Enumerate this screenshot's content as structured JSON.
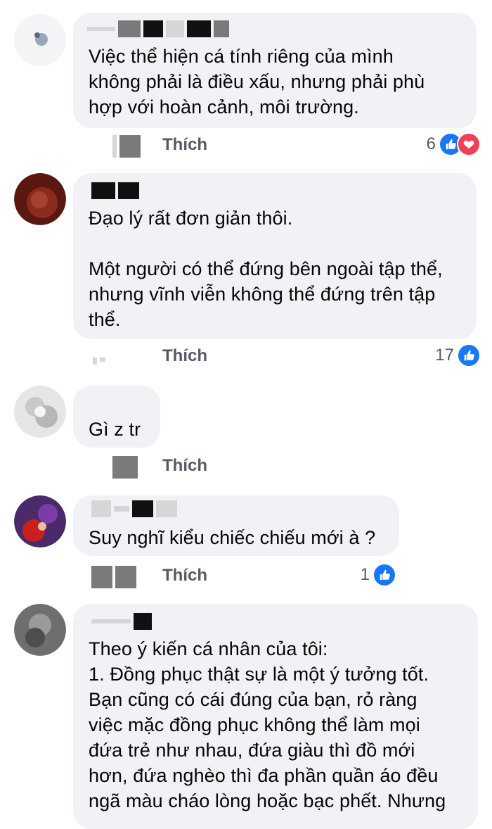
{
  "action_label": "Thích",
  "comments": [
    {
      "text": "Việc thể hiện cá tính riêng của mình\nkhông phải là điều xấu, nhưng phải phù\nhợp với hoàn cảnh, môi trường.",
      "count": "6",
      "reactions": [
        "like-icon",
        "love-icon"
      ]
    },
    {
      "text": "Đạo lý rất đơn giản thôi.\n\nMột người có thể đứng bên ngoài tập thể,\nnhưng vĩnh viễn không thể đứng trên tập\nthể.",
      "count": "17",
      "reactions": [
        "like-icon"
      ]
    },
    {
      "text": "Gì z tr",
      "count": "",
      "reactions": []
    },
    {
      "text": "Suy nghĩ kiểu chiếc chiếu mới à ?",
      "count": "1",
      "reactions": [
        "like-icon"
      ]
    },
    {
      "text": "Theo ý kiến cá nhân của tôi:\n1. Đồng phục thật sự là một ý tưởng tốt.\nBạn cũng có cái đúng của bạn, rỏ ràng\nviệc mặc đồng phục không thể làm mọi\nđứa trẻ như nhau, đứa giàu thì đồ mới\nhơn, đứa nghèo thì đa phần quần áo đều\nngã màu cháo lòng hoặc bạc phết. Nhưng"
    }
  ],
  "colors": {
    "like": "#1877f2",
    "love": "#f33e58",
    "bubble": "#f0f2f5"
  }
}
